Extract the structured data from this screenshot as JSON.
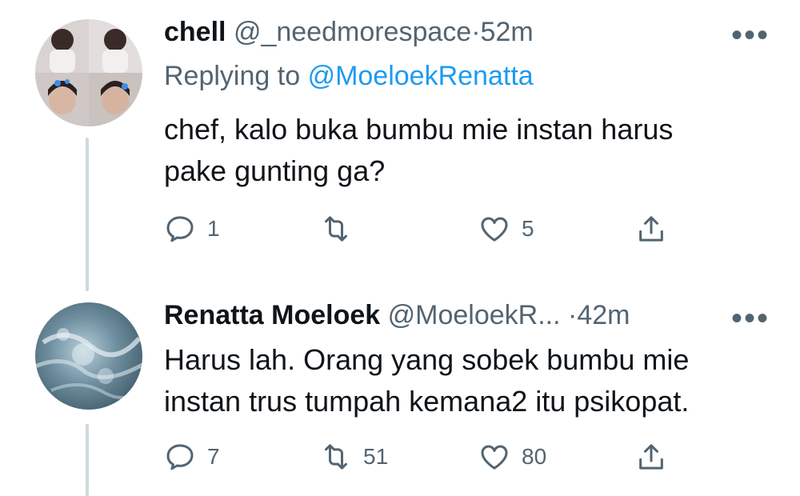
{
  "tweets": [
    {
      "display_name": "chell",
      "handle": "@_needmorespace",
      "separator": "·",
      "time": "52m",
      "reply_prefix": "Replying to",
      "reply_to": "@MoeloekRenatta",
      "text_lines": [
        "chef, kalo buka bumbu mie instan harus",
        "pake gunting ga?"
      ],
      "counts": {
        "replies": "1",
        "retweets": "",
        "likes": "5"
      },
      "more_icon": "more-horizontal-icon"
    },
    {
      "display_name": "Renatta Moeloek",
      "handle": "@MoeloekR...",
      "separator": "·",
      "time": "42m",
      "text_lines": [
        "Harus lah. Orang yang sobek bumbu mie",
        "instan trus tumpah kemana2 itu psikopat."
      ],
      "counts": {
        "replies": "7",
        "retweets": "51",
        "likes": "80"
      },
      "more_icon": "more-horizontal-icon"
    }
  ],
  "colors": {
    "accent": "#1d9bf0",
    "muted": "#536471",
    "text": "#0f1419",
    "thread_line": "#cfd9de"
  },
  "icons": [
    "reply-icon",
    "retweet-icon",
    "like-icon",
    "share-icon"
  ]
}
